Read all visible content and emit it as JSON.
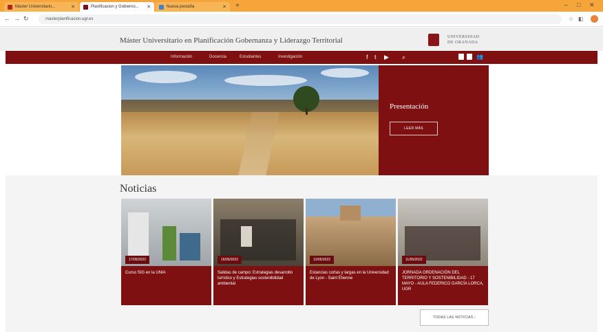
{
  "browser": {
    "tabs": [
      {
        "label": "Master Universitario...",
        "active": false
      },
      {
        "label": "Planificacion y Gobierno...",
        "active": true
      },
      {
        "label": "Nueva pestaña",
        "active": false
      }
    ],
    "new_tab": "+",
    "url": "masterplanificacion.ugr.es",
    "window_controls": [
      "–",
      "□",
      "✕"
    ]
  },
  "site": {
    "title": "Máster Universitario en Planificación Gobernanza y Liderazgo Territorial",
    "university_line1": "UNIVERSIDAD",
    "university_line2": "DE GRANADA",
    "nav": [
      "Información",
      "Docencia",
      "Estudiantes",
      "Investigación"
    ],
    "social": [
      "f",
      "t",
      "▶"
    ],
    "search_icon": "search-icon"
  },
  "hero": {
    "title": "Presentación",
    "button": "LEER MÁS"
  },
  "news": {
    "heading": "Noticias",
    "items": [
      {
        "date": "17/05/2022",
        "title": "Curso SIG en la UNIA"
      },
      {
        "date": "16/05/2022",
        "title": "Salidas de campo: Estrategias desarrollo turístico y Estrategias sostenibilidad ambiental"
      },
      {
        "date": "12/05/2022",
        "title": "Estancias cortas y largas en la Universidad de Lyon - Saint Étienne"
      },
      {
        "date": "11/05/2022",
        "title": "JORNADA ORDENACIÓN DEL TERRITORIO Y SOSTENIBILIDAD - 17 MAYO - AULA FEDERICO GARCÍA LORCA, UGR"
      }
    ],
    "all_button": "TODAS LAS NOTICIAS ›"
  },
  "colors": {
    "brand": "#7e1012",
    "tabbar": "#f6a53a"
  }
}
